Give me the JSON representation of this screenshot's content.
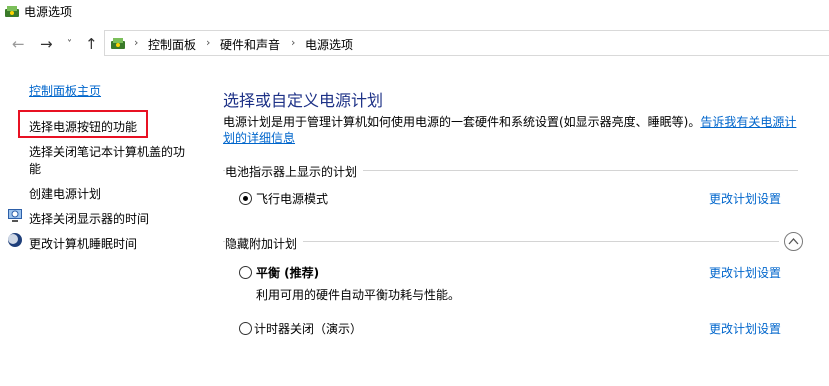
{
  "window": {
    "title": "电源选项",
    "icon": "power-options-icon"
  },
  "nav": {
    "back_icon": "arrow-left-icon",
    "forward_icon": "arrow-right-icon",
    "recent_icon": "chevron-down-icon",
    "up_icon": "arrow-up-icon",
    "breadcrumb": [
      "控制面板",
      "硬件和声音",
      "电源选项"
    ],
    "separator": "›"
  },
  "sidebar": {
    "home_link": "控制面板主页",
    "items": [
      {
        "label": "选择电源按钮的功能",
        "icon": ""
      },
      {
        "label_line1": "选择关闭笔记本计算机盖的功",
        "label_line2": "能",
        "icon": ""
      },
      {
        "label": "创建电源计划",
        "icon": ""
      },
      {
        "label": "选择关闭显示器的时间",
        "icon": "display-timer-icon"
      },
      {
        "label": "更改计算机睡眠时间",
        "icon": "moon-sleep-icon"
      }
    ]
  },
  "main": {
    "heading": "选择或自定义电源计划",
    "description": "电源计划是用于管理计算机如何使用电源的一套硬件和系统设置(如显示器亮度、睡眠等)。",
    "description_link_part1": "告诉我有关电源计",
    "description_link_part2": "划的详细信息",
    "battery_section": {
      "label": "电池指示器上显示的计划",
      "plans": [
        {
          "name": "飞行电源模式",
          "selected": true,
          "link": "更改计划设置"
        }
      ]
    },
    "hidden_section": {
      "label": "隐藏附加计划",
      "collapse_icon": "chevron-up-icon",
      "plans": [
        {
          "name": "平衡 (推荐)",
          "selected": false,
          "link": "更改计划设置",
          "description": "利用可用的硬件自动平衡功耗与性能。"
        },
        {
          "name": "计时器关闭（演示）",
          "selected": false,
          "link": "更改计划设置"
        }
      ]
    }
  },
  "colors": {
    "link": "#0066cc",
    "heading": "#1e3287",
    "highlight": "#e81123"
  }
}
